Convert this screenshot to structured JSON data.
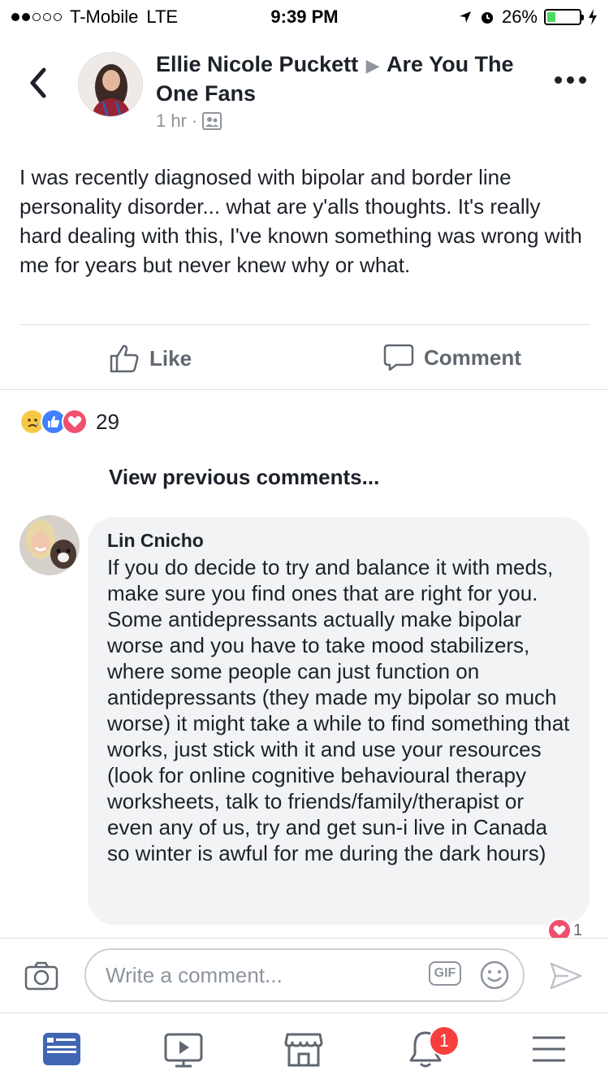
{
  "status_bar": {
    "carrier": "T-Mobile",
    "network": "LTE",
    "time": "9:39 PM",
    "battery": "26%",
    "battery_level": 0.26
  },
  "post": {
    "author": "Ellie Nicole Puckett",
    "group": "Are You The One Fans",
    "time": "1 hr",
    "body": "I was recently diagnosed with bipolar and border line personality disorder... what are y'alls thoughts.  It's really hard dealing with this, I've known something was wrong with me for years but never knew why or what."
  },
  "actions": {
    "like_label": "Like",
    "comment_label": "Comment"
  },
  "reactions": {
    "count": "29",
    "icons": [
      "sad-reaction",
      "like-reaction",
      "love-reaction"
    ]
  },
  "view_previous": "View previous comments...",
  "comment": {
    "author": "Lin Cnicho",
    "text": "If you do decide to try and balance it with meds, make sure you find ones that are right for you. Some antidepressants actually make bipolar worse and you have to take mood stabilizers, where some people can just function on antidepressants (they made my bipolar so much worse) it might take a while to find something that works, just stick with it and use your resources (look for online cognitive behavioural therapy worksheets, talk to friends/family/therapist or even any of us, try and get sun-i live in Canada so winter is awful for me during the dark hours)",
    "reaction_count": "1"
  },
  "composer": {
    "placeholder": "Write a comment...",
    "gif_label": "GIF"
  },
  "tabbar": {
    "notifications_badge": "1"
  },
  "colors": {
    "accent": "#4267b2",
    "text": "#1d2129",
    "secondary_text": "#90949c",
    "badge": "#fa3e3e"
  }
}
